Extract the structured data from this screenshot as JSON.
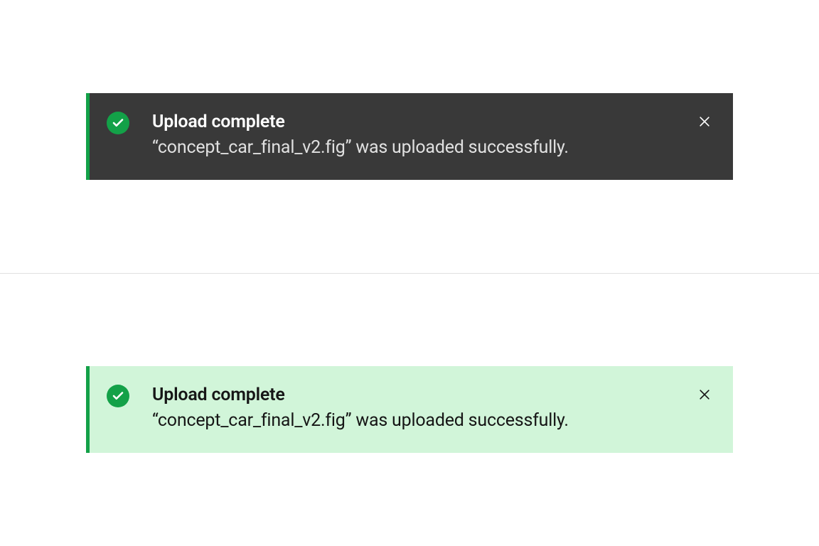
{
  "notifications": [
    {
      "variant": "dark",
      "title": "Upload complete",
      "message": "“concept_car_final_v2.fig” was uploaded successfully.",
      "accent_color": "#13a148",
      "background_color": "#393939"
    },
    {
      "variant": "light",
      "title": "Upload complete",
      "message": "“concept_car_final_v2.fig” was uploaded successfully.",
      "accent_color": "#13a148",
      "background_color": "#d1f5d9"
    }
  ]
}
